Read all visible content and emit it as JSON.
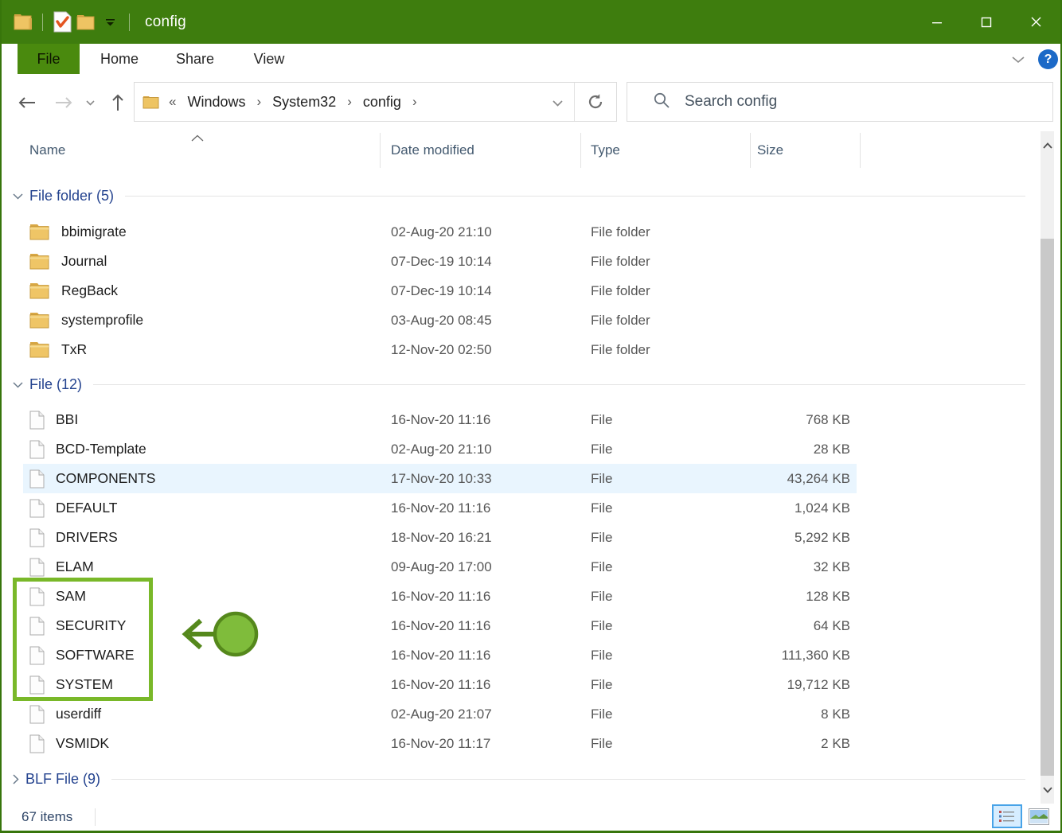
{
  "window": {
    "title": "config"
  },
  "titlebar": {
    "qat": {
      "app_icon": "folder-icon",
      "properties_icon": "document-check-icon",
      "newfolder_icon": "folder-icon",
      "dropdown_icon": "chevron-down-icon"
    },
    "controls": {
      "minimize": "minimize",
      "maximize": "maximize",
      "close": "close"
    }
  },
  "ribbon": {
    "tabs": [
      {
        "label": "File"
      },
      {
        "label": "Home"
      },
      {
        "label": "Share"
      },
      {
        "label": "View"
      }
    ],
    "expand_icon": "chevron-down-icon",
    "help_label": "?"
  },
  "navbar": {
    "breadcrumb": {
      "prefix": "«",
      "items": [
        "Windows",
        "System32",
        "config"
      ],
      "separator": "›"
    },
    "search_placeholder": "Search config"
  },
  "columns": {
    "name": "Name",
    "date": "Date modified",
    "type": "Type",
    "size": "Size"
  },
  "list": {
    "groups": [
      {
        "label": "File folder (5)",
        "collapsed": false,
        "class": "g1",
        "items": [
          {
            "name": "bbimigrate",
            "date": "02-Aug-20 21:10",
            "type": "File folder",
            "size": "",
            "icon": "folder"
          },
          {
            "name": "Journal",
            "date": "07-Dec-19 10:14",
            "type": "File folder",
            "size": "",
            "icon": "folder"
          },
          {
            "name": "RegBack",
            "date": "07-Dec-19 10:14",
            "type": "File folder",
            "size": "",
            "icon": "folder"
          },
          {
            "name": "systemprofile",
            "date": "03-Aug-20 08:45",
            "type": "File folder",
            "size": "",
            "icon": "folder"
          },
          {
            "name": "TxR",
            "date": "12-Nov-20 02:50",
            "type": "File folder",
            "size": "",
            "icon": "folder"
          }
        ]
      },
      {
        "label": "File (12)",
        "collapsed": false,
        "class": "g2",
        "items": [
          {
            "name": "BBI",
            "date": "16-Nov-20 11:16",
            "type": "File",
            "size": "768 KB",
            "icon": "file"
          },
          {
            "name": "BCD-Template",
            "date": "02-Aug-20 21:10",
            "type": "File",
            "size": "28 KB",
            "icon": "file"
          },
          {
            "name": "COMPONENTS",
            "date": "17-Nov-20 10:33",
            "type": "File",
            "size": "43,264 KB",
            "icon": "file",
            "selected": true
          },
          {
            "name": "DEFAULT",
            "date": "16-Nov-20 11:16",
            "type": "File",
            "size": "1,024 KB",
            "icon": "file"
          },
          {
            "name": "DRIVERS",
            "date": "18-Nov-20 16:21",
            "type": "File",
            "size": "5,292 KB",
            "icon": "file"
          },
          {
            "name": "ELAM",
            "date": "09-Aug-20 17:00",
            "type": "File",
            "size": "32 KB",
            "icon": "file"
          },
          {
            "name": "SAM",
            "date": "16-Nov-20 11:16",
            "type": "File",
            "size": "128 KB",
            "icon": "file"
          },
          {
            "name": "SECURITY",
            "date": "16-Nov-20 11:16",
            "type": "File",
            "size": "64 KB",
            "icon": "file"
          },
          {
            "name": "SOFTWARE",
            "date": "16-Nov-20 11:16",
            "type": "File",
            "size": "111,360 KB",
            "icon": "file"
          },
          {
            "name": "SYSTEM",
            "date": "16-Nov-20 11:16",
            "type": "File",
            "size": "19,712 KB",
            "icon": "file"
          },
          {
            "name": "userdiff",
            "date": "02-Aug-20 21:07",
            "type": "File",
            "size": "8 KB",
            "icon": "file"
          },
          {
            "name": "VSMIDK",
            "date": "16-Nov-20 11:17",
            "type": "File",
            "size": "2 KB",
            "icon": "file"
          }
        ]
      },
      {
        "label": "BLF File (9)",
        "collapsed": true,
        "class": "g3",
        "items": []
      }
    ]
  },
  "status": {
    "items_count": "67 items"
  },
  "annotation": {
    "highlighted_files": [
      "SAM",
      "SECURITY",
      "SOFTWARE",
      "SYSTEM"
    ],
    "shape": "box-and-arrow",
    "color": "#79B829"
  },
  "colors": {
    "titlebar_green": "#3E7D0E",
    "file_tab_green": "#4A8A0E",
    "window_border_green": "#37750B",
    "selection_blue": "#E9F5FE",
    "group_header_blue": "#24438F",
    "annotation_green": "#79B829"
  }
}
